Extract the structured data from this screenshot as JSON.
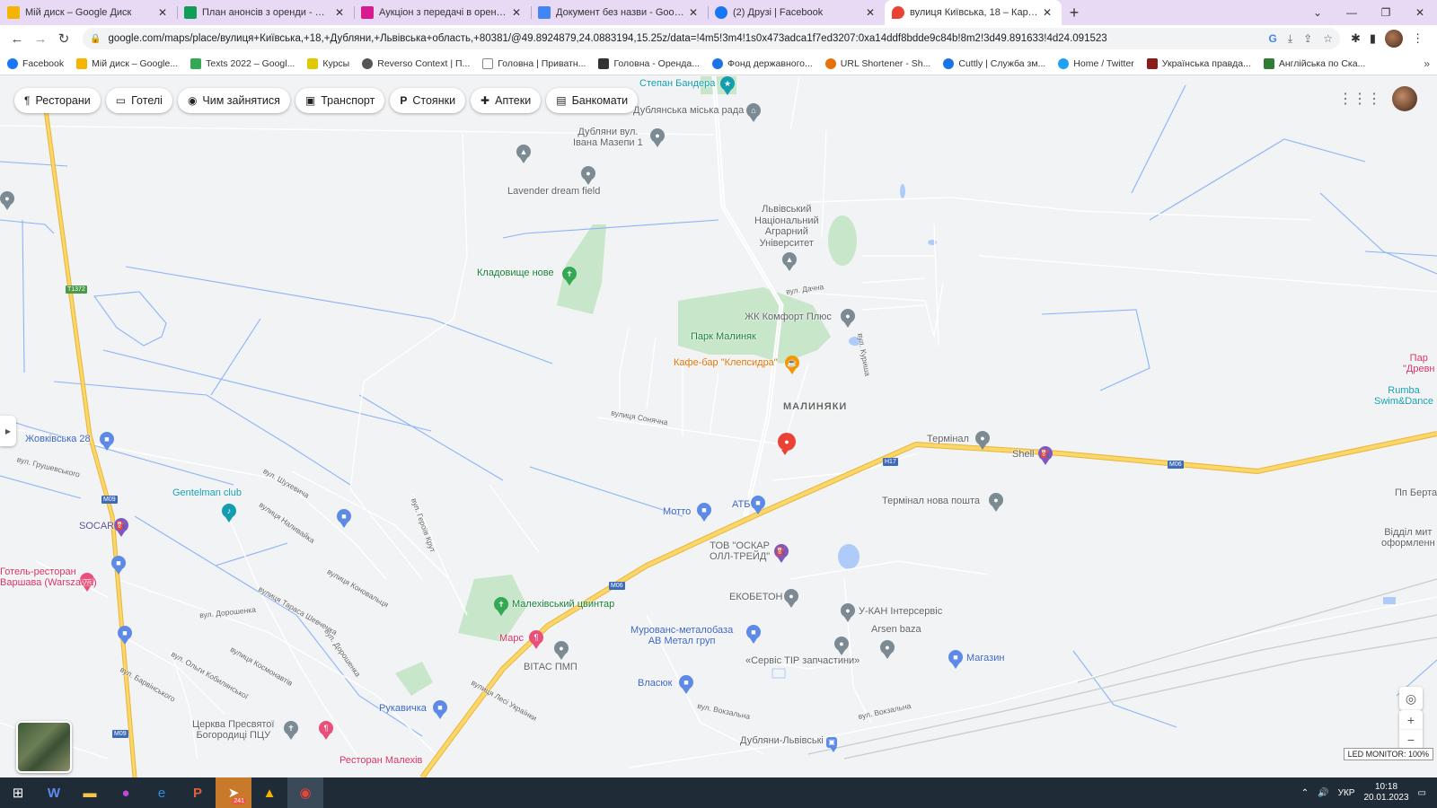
{
  "tabs": [
    {
      "title": "Мій диск – Google Диск",
      "color": "#f4b400",
      "active": false
    },
    {
      "title": "План анонсів з оренди - Google",
      "color": "#0f9d58",
      "active": false
    },
    {
      "title": "Аукціон з передачі в оренду де",
      "color": "#d81b8f",
      "active": false
    },
    {
      "title": "Документ без назви - Google Д",
      "color": "#4285f4",
      "active": false
    },
    {
      "title": "(2) Друзі | Facebook",
      "color": "#1877f2",
      "active": false
    },
    {
      "title": "вулиця Київська, 18 – Карти Go",
      "color": "#ea4335",
      "active": true
    }
  ],
  "tab_close": "✕",
  "new_tab": "+",
  "url": "google.com/maps/place/вулиця+Київська,+18,+Дубляни,+Львівська+область,+80381/@49.8924879,24.0883194,15.25z/data=!4m5!3m4!1s0x473adca1f7ed3207:0xa14ddf8bdde9c84b!8m2!3d49.891633!4d24.091523",
  "bookmarks": [
    {
      "label": "Facebook",
      "color": "#1877f2"
    },
    {
      "label": "Мій диск – Google...",
      "color": "#f4b400"
    },
    {
      "label": "Texts 2022 – Googl...",
      "color": "#34a853"
    },
    {
      "label": "Курсы",
      "color": "#e2c800"
    },
    {
      "label": "Reverso Context | П...",
      "color": "#555555"
    },
    {
      "label": "Головна | Приватн...",
      "color": "#888888"
    },
    {
      "label": "Головна - Оренда...",
      "color": "#333333"
    },
    {
      "label": "Фонд державного...",
      "color": "#1a73e8"
    },
    {
      "label": "URL Shortener - Sh...",
      "color": "#e8710a"
    },
    {
      "label": "Cuttly | Служба зм...",
      "color": "#1a73e8"
    },
    {
      "label": "Home / Twitter",
      "color": "#1da1f2"
    },
    {
      "label": "Українська правда...",
      "color": "#8b1a1a"
    },
    {
      "label": "Англійська по Ска...",
      "color": "#2e7d32"
    }
  ],
  "bookmarks_more": "»",
  "chips": [
    {
      "icon": "¶",
      "label": "Ресторани"
    },
    {
      "icon": "▭",
      "label": "Готелі"
    },
    {
      "icon": "◉",
      "label": "Чим зайнятися"
    },
    {
      "icon": "▣",
      "label": "Транспорт"
    },
    {
      "icon": "P",
      "label": "Стоянки"
    },
    {
      "icon": "✚",
      "label": "Аптеки"
    },
    {
      "icon": "▤",
      "label": "Банкомати"
    }
  ],
  "map": {
    "area_name": "МАЛИНЯКИ",
    "place_labels": {
      "stepan": "Степан Бандера",
      "rada": "Дублянська міська рада",
      "mazepa": "Дубляни вул.\nІвана Мазепи 1",
      "lavender": "Lavender dream field",
      "university": "Львівський\nНаціональний\nАграрний\nУніверситет",
      "cemetery_new": "Кладовище нове",
      "komfort": "ЖК Комфорт Плюс",
      "park": "Парк Малиняк",
      "cafe": "Кафе-бар \"Клепсидра\"",
      "terminal": "Термінал",
      "shell": "Shell",
      "zhovkivska": "Жовківська 28",
      "gentelman": "Gentelman club",
      "socar": "SOCAR",
      "hotel": "Готель-ресторан\nВаршава (Warszawa)",
      "motto": "Мотто",
      "atb": "АТБ",
      "terminal_np": "Термінал нова пошта",
      "oskar": "ТОВ \"ОСКАР\nОЛЛ-ТРЕЙД\"",
      "ekobeton": "ЕКОБЕТОН",
      "ukan": "У-КАН Інтерсервіс",
      "arsen": "Arsen baza",
      "mars": "Марс",
      "vitas": "ВІТАС ПМП",
      "malekhiv_cemetery": "Малехівський цвинтар",
      "metal": "Мурованс-металобаза\nАВ Метал груп",
      "tir": "«Сервіс ТІР запчастини»",
      "magazin": "Магазин",
      "vlasiuk": "Власюк",
      "rukavychka": "Рукавичка",
      "church": "Церква Пресвятої\nБогородиці ПЦУ",
      "dubliany_station": "Дубляни-Львівські",
      "restaurant": "Ресторан Малехів",
      "park_right": "Пар\n\"Древн",
      "rumba": "Rumba\nSwim&Dance",
      "pp_berta": "Пп Берта",
      "viddil": "Відділ мит\nоформленн"
    },
    "streets": {
      "dachna": "вул. Дачна",
      "kurisha": "вул. Куриша",
      "sonyachna": "вулиця Сонячна",
      "hrushevskoho": "вул. Грушевського",
      "shukhevycha": "вул. Шухевича",
      "nalyvaika": "вулиця Наливайка",
      "shevchenka": "вулиця Тараса Шевченка",
      "konovaltsia": "вулиця Коновальця",
      "doroshenka": "вул. Дорошенка",
      "kosmonavtiv": "вулиця Космонавтів",
      "kobylianskoi": "вул. Ольги Кобилянської",
      "barvinskoho": "вул. Барвінського",
      "hroni_kut": "вул. Героїв Крут",
      "lesi": "вулиця Лесі Українки",
      "vokzalna": "вул. Вокзальна",
      "vokzalna2": "вул. Вокзальна"
    },
    "route_shields": {
      "h17": "H17",
      "m06_a": "M06",
      "m06_b": "M06",
      "m09_a": "M09",
      "m09_b": "M09",
      "t1372": "T1372"
    }
  },
  "controls": {
    "sidebar_toggle": "▶",
    "locate": "◎",
    "zoom_in": "+",
    "zoom_out": "−",
    "monitor": "LED MONITOR: 100%"
  },
  "taskbar": {
    "telegram_badge": "241",
    "lang": "УКР",
    "time": "10:18",
    "date": "20.01.2023"
  }
}
